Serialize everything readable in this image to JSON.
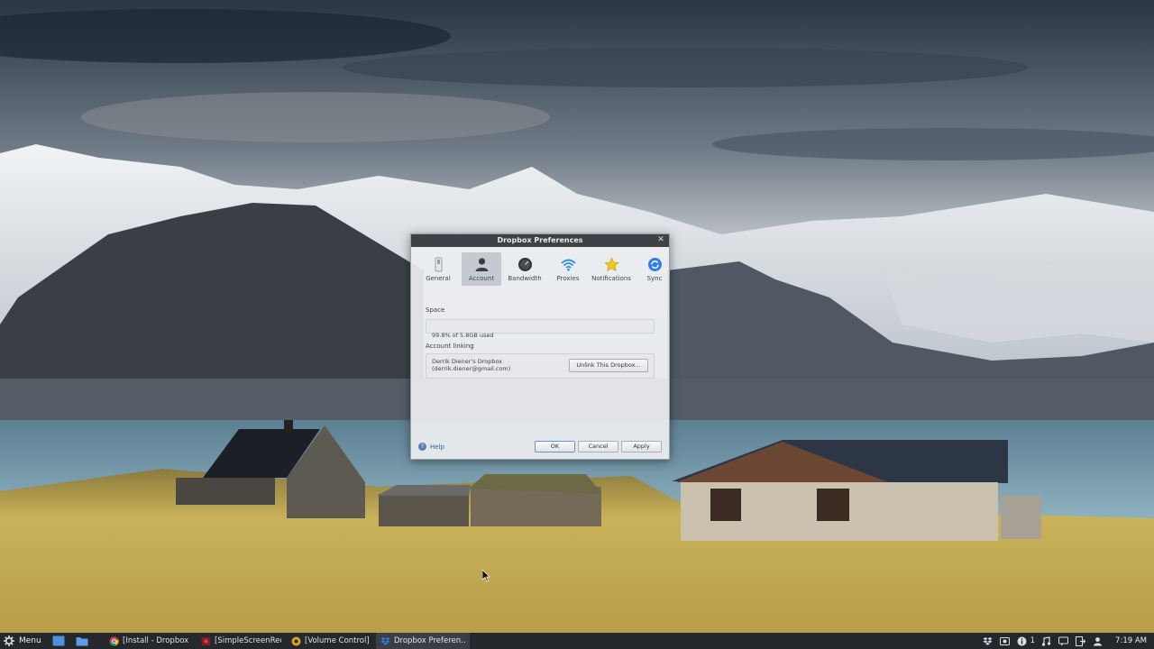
{
  "dialog": {
    "title": "Dropbox Preferences",
    "close_glyph": "✕",
    "tabs": [
      {
        "label": "General",
        "icon": "switch-icon"
      },
      {
        "label": "Account",
        "icon": "user-icon",
        "active": true
      },
      {
        "label": "Bandwidth",
        "icon": "gauge-icon"
      },
      {
        "label": "Proxies",
        "icon": "wifi-icon"
      },
      {
        "label": "Notifications",
        "icon": "star-icon"
      },
      {
        "label": "Sync",
        "icon": "sync-icon"
      }
    ],
    "space": {
      "label": "Space",
      "usage_text": "99.8% of 5.8GB used"
    },
    "account_linking": {
      "label": "Account linking",
      "account_name": "Derrik Diener's Dropbox",
      "account_email": "(derrik.diener@gmail.com)",
      "unlink_button": "Unlink This Dropbox..."
    },
    "footer": {
      "help_label": "Help",
      "ok_label": "OK",
      "cancel_label": "Cancel",
      "apply_label": "Apply"
    }
  },
  "taskbar": {
    "menu_label": "Menu",
    "tasks": [
      {
        "label": "[Install - Dropbox -...",
        "icon": "chrome-icon"
      },
      {
        "label": "[SimpleScreenRec...",
        "icon": "recorder-icon"
      },
      {
        "label": "[Volume Control]",
        "icon": "volume-icon"
      },
      {
        "label": "Dropbox Preferen...",
        "icon": "dropbox-icon",
        "active": true
      }
    ],
    "tray": {
      "notification_count": "1",
      "clock": "7:19 AM"
    }
  },
  "colors": {
    "titlebar": "#3e4247",
    "taskbar": "#24272b",
    "link": "#2a61b8",
    "dropbox_blue": "#2f7ee8"
  }
}
